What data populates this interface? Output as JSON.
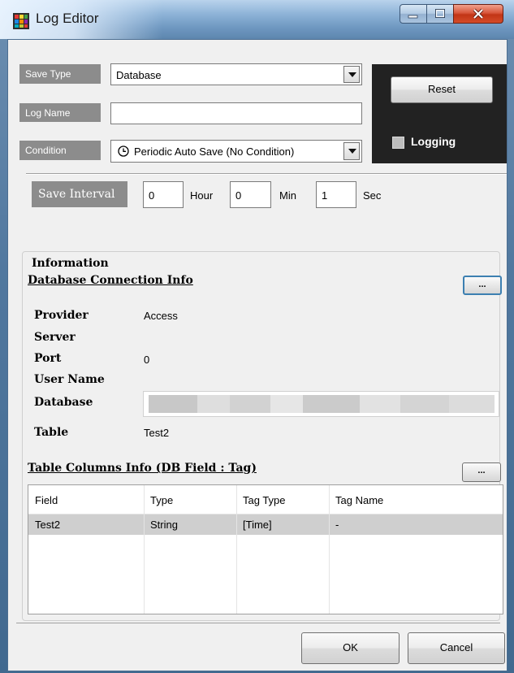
{
  "window": {
    "title": "Log Editor"
  },
  "colors": {
    "label_bg": "#8c8c8c",
    "dark_panel": "#222222",
    "row_selected": "#cfcfcf",
    "close_button": "#c13516"
  },
  "icons": [
    "app-icon",
    "minimize-icon",
    "maximize-icon",
    "close-icon",
    "clock-icon",
    "chevron-down-icon",
    "ellipsis-icon"
  ],
  "settings": {
    "save_type": {
      "label": "Save Type",
      "value": "Database"
    },
    "log_name": {
      "label": "Log Name",
      "value": ""
    },
    "condition": {
      "label": "Condition",
      "value": "Periodic Auto Save (No Condition)"
    },
    "reset_label": "Reset",
    "logging_label": "Logging",
    "save_interval": {
      "label": "Save Interval",
      "hour": "0",
      "hour_unit": "Hour",
      "min": "0",
      "min_unit": "Min",
      "sec": "1",
      "sec_unit": "Sec"
    }
  },
  "information": {
    "group_title": "Information",
    "db_section_title": "Database Connection Info",
    "db_button": "...",
    "fields": {
      "provider": {
        "label": "Provider",
        "value": "Access"
      },
      "server": {
        "label": "Server",
        "value": ""
      },
      "port": {
        "label": "Port",
        "value": "0"
      },
      "user_name": {
        "label": "User Name",
        "value": ""
      },
      "database": {
        "label": "Database",
        "value": ""
      },
      "table": {
        "label": "Table",
        "value": "Test2"
      }
    },
    "columns_section_title": "Table Columns Info (DB Field : Tag)",
    "columns_button": "...",
    "columns": {
      "headers": [
        "Field",
        "Type",
        "Tag Type",
        "Tag Name"
      ],
      "rows": [
        [
          "Test2",
          "String",
          "[Time]",
          "-"
        ]
      ]
    }
  },
  "footer": {
    "ok_label": "OK",
    "cancel_label": "Cancel"
  }
}
